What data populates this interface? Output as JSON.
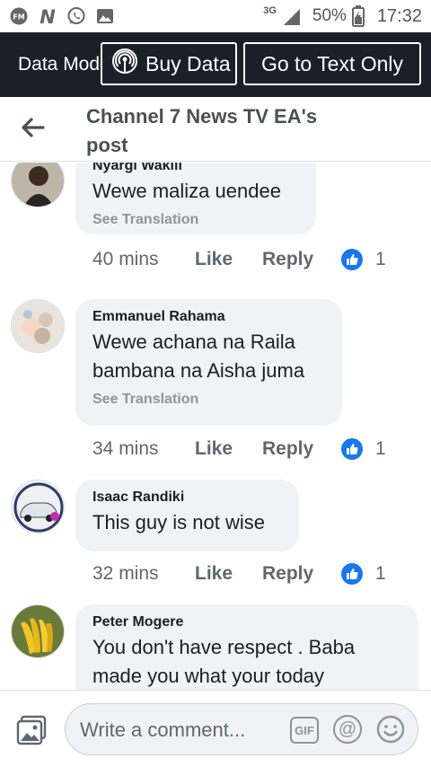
{
  "status_bar": {
    "network": "3G",
    "battery": "50%",
    "time": "17:32"
  },
  "data_bar": {
    "mode_label": "Data Mode",
    "buy_label": "Buy Data",
    "text_only_label": "Go to Text Only"
  },
  "header": {
    "title": "Channel 7 News TV EA's post"
  },
  "comments": [
    {
      "author": "Nyargi Wakili",
      "text": "Wewe maliza uendee",
      "translation_label": "See Translation",
      "time": "40 mins",
      "like_label": "Like",
      "reply_label": "Reply",
      "reaction_count": "1"
    },
    {
      "author": "Emmanuel Rahama",
      "text": "Wewe achana na Raila bambana na Aisha juma",
      "translation_label": "See Translation",
      "time": "34 mins",
      "like_label": "Like",
      "reply_label": "Reply",
      "reaction_count": "1"
    },
    {
      "author": "Isaac Randiki",
      "text": "This guy is not wise",
      "time": "32 mins",
      "like_label": "Like",
      "reply_label": "Reply",
      "reaction_count": "1"
    },
    {
      "author": "Peter Mogere",
      "text": "You don't have respect . Baba made you what your today"
    }
  ],
  "composer": {
    "placeholder": "Write a comment...",
    "gif_label": "GIF",
    "mention_label": "@"
  },
  "icons": {
    "back": "arrow-left-icon",
    "photo": "photo-icon",
    "like_reaction": "thumbs-up-icon",
    "emoji": "smiley-icon"
  },
  "colors": {
    "facebook_blue": "#1877f2",
    "data_bar_bg": "#1c1f27",
    "bubble_bg": "#f0f2f5"
  }
}
